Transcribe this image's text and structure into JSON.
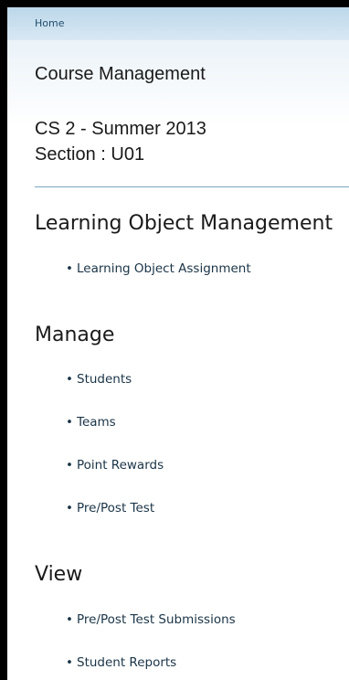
{
  "breadcrumb": {
    "home": "Home"
  },
  "header": {
    "course_management": "Course Management",
    "course": "CS 2 - Summer 2013",
    "section": "Section : U01"
  },
  "groups": [
    {
      "title": "Learning Object Management",
      "items": [
        "Learning Object Assignment"
      ]
    },
    {
      "title": "Manage",
      "items": [
        "Students",
        "Teams",
        "Point Rewards",
        "Pre/Post Test"
      ]
    },
    {
      "title": "View",
      "items": [
        "Pre/Post Test Submissions",
        "Student Reports"
      ]
    }
  ],
  "bullet_char": "•",
  "colors": {
    "header_bar": "#bcd7ea",
    "divider": "#7aa6c2",
    "link": "#1a3447"
  }
}
